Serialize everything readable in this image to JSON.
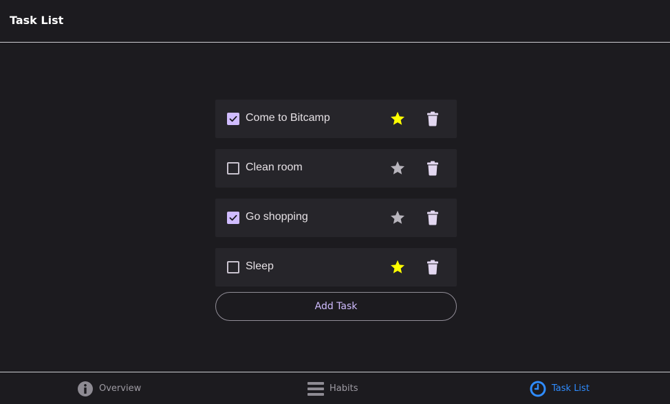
{
  "header": {
    "title": "Task List"
  },
  "tasks": [
    {
      "label": "Come to Bitcamp",
      "completed": true,
      "starred": true
    },
    {
      "label": "Clean room",
      "completed": false,
      "starred": false
    },
    {
      "label": "Go shopping",
      "completed": true,
      "starred": false
    },
    {
      "label": "Sleep",
      "completed": false,
      "starred": true
    }
  ],
  "add_task_label": "Add Task",
  "nav": {
    "items": [
      {
        "label": "Overview",
        "icon": "info-icon",
        "active": false
      },
      {
        "label": "Habits",
        "icon": "menu-icon",
        "active": false
      },
      {
        "label": "Task List",
        "icon": "clock-icon",
        "active": true
      }
    ]
  },
  "colors": {
    "background": "#1c1b1f",
    "row": "#26252a",
    "accent": "#d0bcff",
    "star_active": "#ffff00",
    "star_inactive": "#b8b5bd",
    "nav_active": "#2f8cff"
  }
}
